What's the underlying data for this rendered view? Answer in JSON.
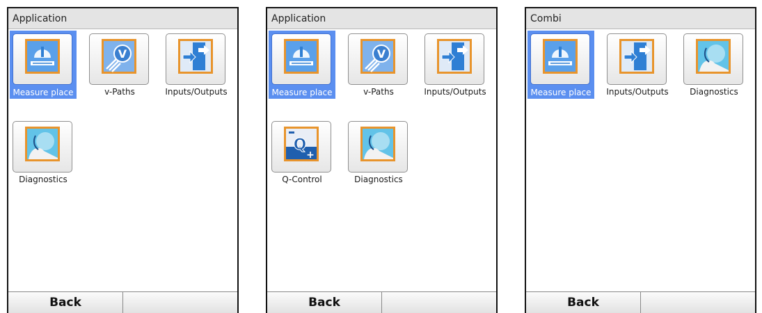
{
  "screens": [
    {
      "title": "Application",
      "tiles": [
        {
          "label": "Measure place",
          "icon": "measure-place-icon",
          "selected": true
        },
        {
          "label": "v-Paths",
          "icon": "v-paths-icon",
          "selected": false
        },
        {
          "label": "Inputs/Outputs",
          "icon": "inputs-outputs-icon",
          "selected": false
        },
        {
          "label": "Diagnostics",
          "icon": "diagnostics-icon",
          "selected": false
        }
      ],
      "softkeys": [
        "Back",
        ""
      ]
    },
    {
      "title": "Application",
      "tiles": [
        {
          "label": "Measure place",
          "icon": "measure-place-icon",
          "selected": true
        },
        {
          "label": "v-Paths",
          "icon": "v-paths-icon",
          "selected": false
        },
        {
          "label": "Inputs/Outputs",
          "icon": "inputs-outputs-icon",
          "selected": false
        },
        {
          "label": "Q-Control",
          "icon": "q-control-icon",
          "selected": false
        },
        {
          "label": "Diagnostics",
          "icon": "diagnostics-icon",
          "selected": false
        }
      ],
      "softkeys": [
        "Back",
        ""
      ]
    },
    {
      "title": "Combi",
      "tiles": [
        {
          "label": "Measure place",
          "icon": "measure-place-icon",
          "selected": true
        },
        {
          "label": "Inputs/Outputs",
          "icon": "inputs-outputs-icon",
          "selected": false
        },
        {
          "label": "Diagnostics",
          "icon": "diagnostics-icon",
          "selected": false
        }
      ],
      "softkeys": [
        "Back",
        ""
      ]
    }
  ],
  "colors": {
    "selection": "#5b8ff0",
    "icon_border": "#e8942c",
    "icon_blue": "#2f7fd4"
  }
}
